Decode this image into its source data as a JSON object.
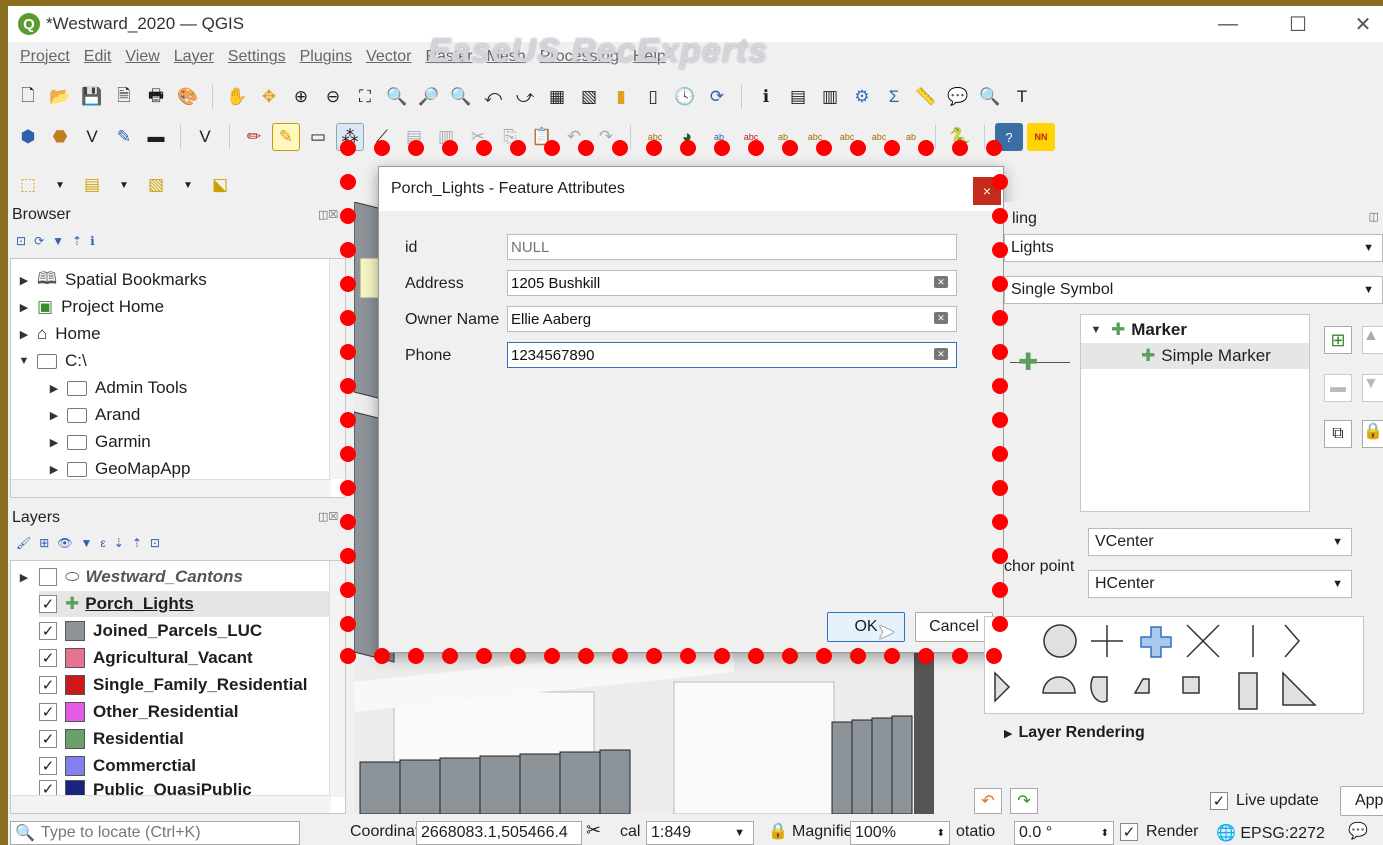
{
  "window": {
    "title": "*Westward_2020 — QGIS",
    "minimize": "—",
    "maximize": "☐",
    "close": "✕"
  },
  "watermark": "EaseUS RecExperts",
  "menu": [
    "Project",
    "Edit",
    "View",
    "Layer",
    "Settings",
    "Plugins",
    "Vector",
    "Raster",
    "Mesh",
    "Processing",
    "Help"
  ],
  "browser": {
    "title": "Browser",
    "items": [
      {
        "label": "Spatial Bookmarks",
        "indent": 0
      },
      {
        "label": "Project Home",
        "indent": 0
      },
      {
        "label": "Home",
        "indent": 0
      },
      {
        "label": "C:\\",
        "indent": 0
      },
      {
        "label": "Admin Tools",
        "indent": 1
      },
      {
        "label": "Arand",
        "indent": 1
      },
      {
        "label": "Garmin",
        "indent": 1
      },
      {
        "label": "GeoMapApp",
        "indent": 1
      }
    ]
  },
  "layers": {
    "title": "Layers",
    "items": [
      {
        "label": "Westward_Cantons",
        "checked": false,
        "color": "#ffffff",
        "style": "italic"
      },
      {
        "label": "Porch_Lights",
        "checked": true,
        "color": "#5aa05a",
        "style": "underline"
      },
      {
        "label": "Joined_Parcels_LUC",
        "checked": true,
        "color": "#8c9399",
        "style": "bold"
      },
      {
        "label": "Agricultural_Vacant",
        "checked": true,
        "color": "#e6738f",
        "style": "bold"
      },
      {
        "label": "Single_Family_Residential",
        "checked": true,
        "color": "#cc1a1a",
        "style": "bold"
      },
      {
        "label": "Other_Residential",
        "checked": true,
        "color": "#e45be4",
        "style": "bold"
      },
      {
        "label": "Residential",
        "checked": true,
        "color": "#6aa06a",
        "style": "bold"
      },
      {
        "label": "Commerctial",
        "checked": true,
        "color": "#8080ee",
        "style": "bold"
      },
      {
        "label": "Public_QuasiPublic",
        "checked": true,
        "color": "#1a237e",
        "style": "bold"
      }
    ]
  },
  "dialog": {
    "title": "Porch_Lights - Feature Attributes",
    "close": "×",
    "fields": [
      {
        "label": "id",
        "value": "",
        "placeholder": "NULL"
      },
      {
        "label": "Address",
        "value": "1205 Bushkill",
        "placeholder": ""
      },
      {
        "label": "Owner Name",
        "value": "Ellie Aaberg",
        "placeholder": ""
      },
      {
        "label": "Phone",
        "value": "1234567890",
        "placeholder": ""
      }
    ],
    "ok": "OK",
    "cancel": "Cancel"
  },
  "styling": {
    "title_fragment": "ling",
    "layer": "Lights",
    "renderer": "Single Symbol",
    "tree": [
      {
        "label": "Marker"
      },
      {
        "label": "Simple Marker"
      }
    ],
    "vcenter": "VCenter",
    "anchor_label": "chor point",
    "hcenter": "HCenter",
    "rendering": "Layer Rendering",
    "live_update": "Live update",
    "apply": "Apply"
  },
  "status": {
    "locate_placeholder": "Type to locate (Ctrl+K)",
    "coord_label": "Coordinat",
    "coord_value": "2668083.1,505466.4",
    "scale_label": "cal",
    "scale_value": "1:849",
    "magnifier_label": "Magnifie",
    "magnifier_value": "100%",
    "rotation_label": "otatio",
    "rotation_value": "0.0 °",
    "render_label": "Render",
    "crs": "EPSG:2272"
  },
  "colors": {
    "accent_red": "#ff0000",
    "close_red": "#c42b1c",
    "qgis_green": "#5a9a2e"
  }
}
